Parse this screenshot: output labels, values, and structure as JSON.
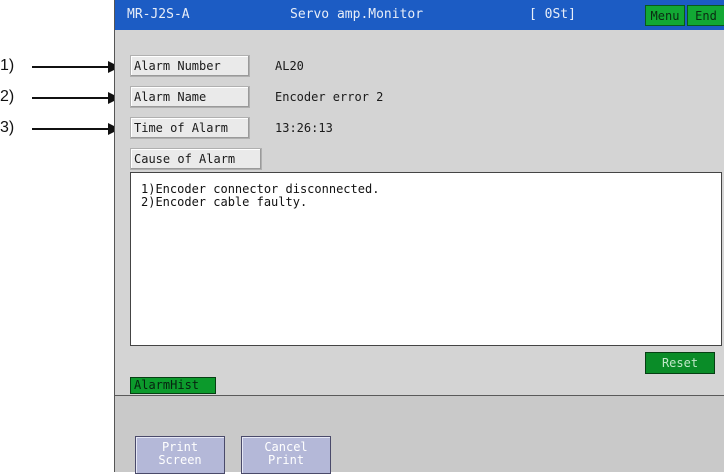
{
  "titlebar": {
    "model": "MR-J2S-A",
    "title": "Servo amp.Monitor",
    "status": "[ 0St]",
    "menu_label": "Menu",
    "end_label": "End"
  },
  "fields": {
    "alarm_number": {
      "label": "Alarm Number",
      "value": "AL20"
    },
    "alarm_name": {
      "label": "Alarm Name",
      "value": "Encoder error 2"
    },
    "time_of_alarm": {
      "label": "Time of Alarm",
      "value": "13:26:13"
    },
    "cause_of_alarm": {
      "label": "Cause of Alarm"
    }
  },
  "causes": [
    "1)Encoder connector disconnected.",
    "2)Encoder cable faulty."
  ],
  "buttons": {
    "reset": "Reset",
    "alarm_hist": "AlarmHist",
    "print_screen": [
      "Print",
      "Screen"
    ],
    "cancel_print": [
      "Cancel",
      "Print"
    ]
  },
  "callouts": [
    "1)",
    "2)",
    "3)"
  ],
  "colors": {
    "titlebar": "#1c5cc4",
    "menu_green": "#12a834",
    "reset_green": "#0a8c28",
    "print_button": "#b4b8d8"
  }
}
